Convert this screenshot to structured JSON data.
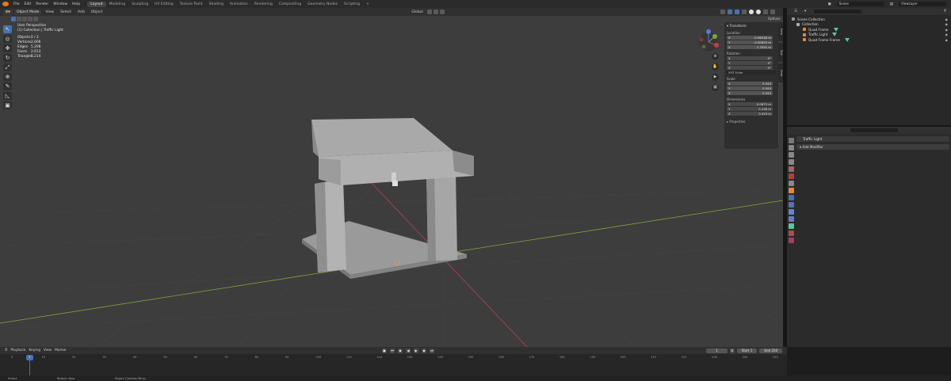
{
  "topbar": {
    "menus": [
      "File",
      "Edit",
      "Render",
      "Window",
      "Help"
    ],
    "workspaces": [
      "Layout",
      "Modeling",
      "Sculpting",
      "UV Editing",
      "Texture Paint",
      "Shading",
      "Animation",
      "Rendering",
      "Compositing",
      "Geometry Nodes",
      "Scripting"
    ],
    "add_tab": "+",
    "scene": "Scene",
    "view_layer": "ViewLayer"
  },
  "viewport": {
    "mode": "Object Mode",
    "menus": [
      "View",
      "Select",
      "Add",
      "Object"
    ],
    "transform_orientation": "Global",
    "view_name": "User Perspective",
    "collection_path": "(1) Collection | Traffic Light",
    "stats": [
      {
        "label": "Objects",
        "value": "0 / 3"
      },
      {
        "label": "Vertices",
        "value": "2,606"
      },
      {
        "label": "Edges",
        "value": "5,208"
      },
      {
        "label": "Faces",
        "value": "2,613"
      },
      {
        "label": "Triangles",
        "value": "5,214"
      }
    ],
    "options_label": "Options"
  },
  "npanel": {
    "header": "Transform",
    "location_label": "Location",
    "location": [
      {
        "axis": "X",
        "value": "-0.96048 m"
      },
      {
        "axis": "Y",
        "value": "-0.00825 m"
      },
      {
        "axis": "Z",
        "value": "1.7001 m"
      }
    ],
    "rotation_label": "Rotation",
    "rotation": [
      {
        "axis": "X",
        "value": "0°"
      },
      {
        "axis": "Y",
        "value": "0°"
      },
      {
        "axis": "Z",
        "value": "0°"
      }
    ],
    "rotation_mode": "XYZ Euler",
    "scale_label": "Scale",
    "scale": [
      {
        "axis": "X",
        "value": "0.344"
      },
      {
        "axis": "Y",
        "value": "0.344"
      },
      {
        "axis": "Z",
        "value": "0.344"
      }
    ],
    "dimensions_label": "Dimensions",
    "dimensions": [
      {
        "axis": "X",
        "value": "0.0673 m"
      },
      {
        "axis": "Y",
        "value": "0.148 m"
      },
      {
        "axis": "Z",
        "value": "0.419 m"
      }
    ],
    "properties_label": "Properties",
    "tabs": [
      "Item",
      "Tool",
      "View"
    ]
  },
  "outliner": {
    "root": "Scene Collection",
    "collection": "Collection",
    "items": [
      "Quad Frame",
      "Traffic Light",
      "Quad Frame Frame"
    ]
  },
  "properties": {
    "object_name": "Traffic Light",
    "add_modifier": "Add Modifier"
  },
  "timeline": {
    "menus": [
      "Playback",
      "Keying",
      "View",
      "Marker"
    ],
    "current_frame": "1",
    "start_label": "Start",
    "start": "1",
    "end_label": "End",
    "end": "250",
    "ruler": [
      "0",
      "10",
      "20",
      "30",
      "40",
      "50",
      "60",
      "70",
      "80",
      "90",
      "100",
      "110",
      "120",
      "130",
      "140",
      "150",
      "160",
      "170",
      "180",
      "190",
      "200",
      "210",
      "220",
      "230",
      "240",
      "250"
    ]
  },
  "statusbar": {
    "items": [
      "Select",
      "Rotate View",
      "Object Context Menu"
    ]
  },
  "colors": {
    "accent": "#4772b3",
    "viewport_bg": "#3d3d3d",
    "x_axis": "#b8434e",
    "y_axis": "#7fa63b",
    "z_axis": "#4f7fd6"
  }
}
